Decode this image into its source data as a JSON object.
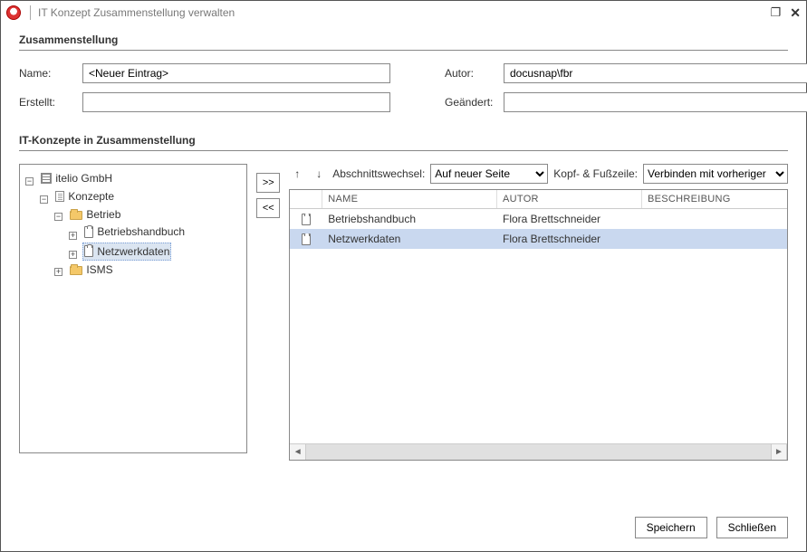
{
  "window": {
    "title": "IT Konzept Zusammenstellung verwalten"
  },
  "sections": {
    "compilation": "Zusammenstellung",
    "concepts": "IT-Konzepte in Zusammenstellung"
  },
  "form": {
    "name_label": "Name:",
    "name_value": "<Neuer Eintrag>",
    "author_label": "Autor:",
    "author_value": "docusnap\\fbr",
    "created_label": "Erstellt:",
    "created_value": "",
    "modified_label": "Geändert:",
    "modified_value": ""
  },
  "toolbar": {
    "move_up": "↑",
    "move_down": "↓",
    "section_label": "Abschnittswechsel:",
    "section_value": "Auf neuer Seite",
    "header_label": "Kopf- & Fußzeile:",
    "header_value": "Verbinden mit vorheriger",
    "add": ">>",
    "remove": "<<"
  },
  "tree": {
    "root": {
      "label": "itelio GmbH",
      "icon": "building"
    },
    "concepts": {
      "label": "Konzepte",
      "icon": "doc"
    },
    "betrieb": {
      "label": "Betrieb",
      "icon": "folder"
    },
    "handbuch": {
      "label": "Betriebshandbuch",
      "icon": "clip"
    },
    "netz": {
      "label": "Netzwerkdaten",
      "icon": "clip"
    },
    "isms": {
      "label": "ISMS",
      "icon": "folder"
    }
  },
  "table": {
    "columns": {
      "name": "NAME",
      "author": "AUTOR",
      "desc": "BESCHREIBUNG"
    },
    "rows": [
      {
        "name": "Betriebshandbuch",
        "author": "Flora Brettschneider",
        "desc": "",
        "selected": false
      },
      {
        "name": "Netzwerkdaten",
        "author": "Flora Brettschneider",
        "desc": "",
        "selected": true
      }
    ]
  },
  "footer": {
    "save": "Speichern",
    "close": "Schließen"
  }
}
